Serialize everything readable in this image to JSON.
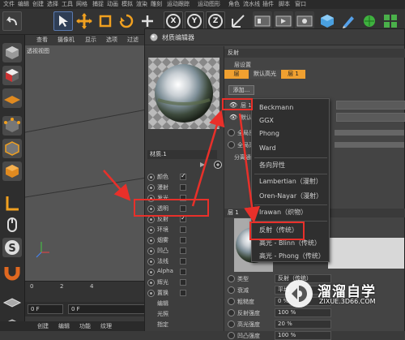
{
  "menubar": [
    "文件",
    "编辑",
    "创建",
    "选择",
    "工具",
    "网格",
    "捕捉",
    "动画",
    "模拟",
    "渲染",
    "雕刻",
    "运动跟踪",
    "运动图形",
    "角色",
    "流水线",
    "插件",
    "脚本",
    "窗口"
  ],
  "toolbar": {
    "x": "X",
    "y": "Y",
    "z": "Z"
  },
  "viewport": {
    "menu": [
      "查看",
      "摄像机",
      "显示",
      "选项",
      "过滤"
    ],
    "label": "透视视图"
  },
  "timeline": {
    "marks": [
      "0",
      "2",
      "4"
    ],
    "frame": "0 F",
    "frame_end": "0 F"
  },
  "bottom_menu": [
    "创建",
    "编辑",
    "功能",
    "纹理"
  ],
  "editor": {
    "title": "材质编辑器",
    "material_name": "材质.1",
    "channels": [
      {
        "label": "颜色",
        "checked": true
      },
      {
        "label": "漫射",
        "checked": false
      },
      {
        "label": "发光",
        "checked": false
      },
      {
        "label": "透明",
        "checked": false
      },
      {
        "label": "反射",
        "checked": true
      },
      {
        "label": "环境",
        "checked": false
      },
      {
        "label": "烟雾",
        "checked": false
      },
      {
        "label": "凹凸",
        "checked": false
      },
      {
        "label": "法线",
        "checked": false
      },
      {
        "label": "Alpha",
        "checked": false
      },
      {
        "label": "辉光",
        "checked": false
      },
      {
        "label": "置换",
        "checked": false
      }
    ],
    "extra_items": [
      "编辑",
      "光照",
      "指定"
    ],
    "right": {
      "section": "反射",
      "layer_settings": "层设置",
      "tabs": [
        "层",
        "默认高光",
        "层 1"
      ],
      "add_button": "添加...",
      "layers": [
        "层 1",
        "默认高"
      ],
      "global_rows": [
        "全局反",
        "全局高",
        "分离通"
      ],
      "layer1_header": "层 1",
      "props": [
        {
          "label": "类型",
          "value": "反射（传统）"
        },
        {
          "label": "衰减",
          "value": "平均"
        },
        {
          "label": "粗糙度",
          "value": "0 %"
        },
        {
          "label": "反射强度",
          "value": "100 %"
        },
        {
          "label": "高光强度",
          "value": "20 %"
        },
        {
          "label": "凹凸强度",
          "value": "100 %"
        }
      ]
    }
  },
  "dropdown": {
    "group1": [
      "Beckmann",
      "GGX",
      "Phong",
      "Ward"
    ],
    "group2": [
      "各向异性"
    ],
    "group3": [
      "Lambertian（漫射）",
      "Oren-Nayar（漫射）"
    ],
    "group4": [
      "Irawan（织物）"
    ],
    "group5": [
      "反射（传统）",
      "高光 - Blinn（传统）",
      "高光 - Phong（传统）"
    ]
  },
  "watermark": {
    "title": "溜溜自学",
    "sub": "ZIXUE.3D66.COM"
  },
  "colors": {
    "highlight": "#e8302a",
    "tab_active": "#f0a030",
    "arrow": "#e8302a"
  }
}
